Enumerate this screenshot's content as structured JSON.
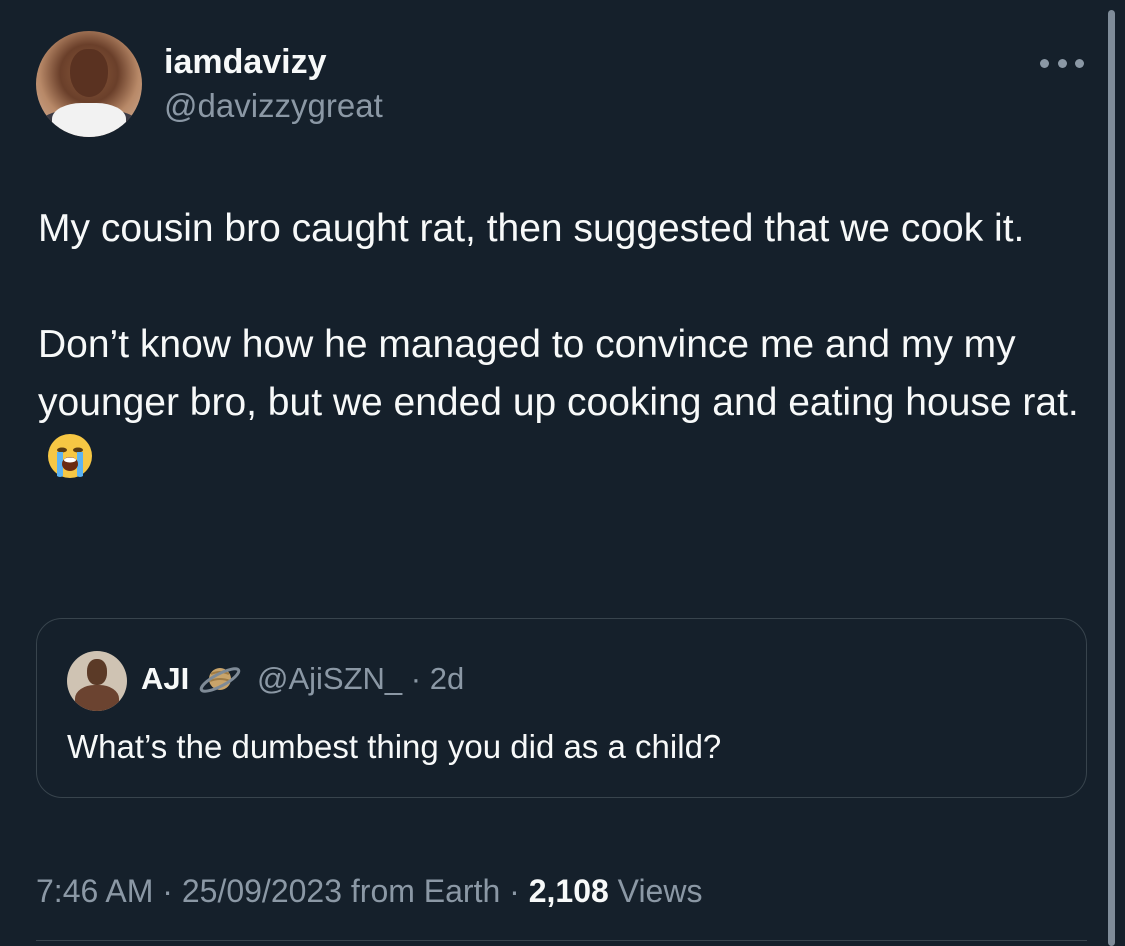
{
  "tweet": {
    "author": {
      "display_name": "iamdavizy",
      "handle": "@davizzygreat"
    },
    "paragraphs": [
      "My cousin bro caught rat, then suggested that we cook it.",
      "Don’t know how he managed to convince me and my my younger bro, but we ended up cooking and eating house rat."
    ],
    "emoji": "loudly-crying-face",
    "quoted": {
      "display_name": "AJI",
      "badge_icon": "ringed-planet-icon",
      "handle": "@AjiSZN_",
      "time_sep": "·",
      "age": "2d",
      "text": "What’s the dumbest thing you did as a child?"
    },
    "meta": {
      "time": "7:46 AM",
      "sep1": "·",
      "date": "25/09/2023",
      "source": "from Earth",
      "sep2": "·",
      "views_count": "2,108",
      "views_label": "Views"
    }
  },
  "colors": {
    "background": "#15202b",
    "primary_text": "#f7f9f9",
    "secondary_text": "#8b98a5",
    "border": "#38444d"
  }
}
